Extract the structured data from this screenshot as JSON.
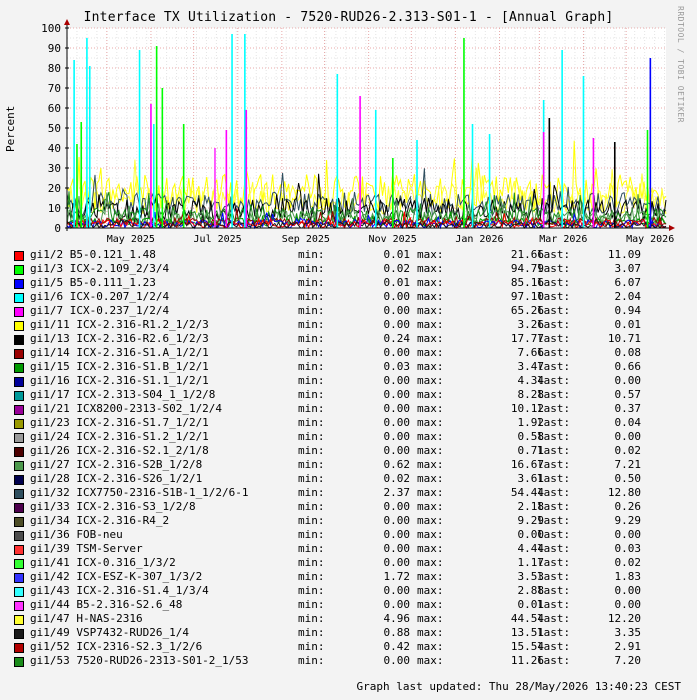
{
  "chart_data": {
    "type": "line",
    "title": "Interface TX Utilization - 7520-RUD26-2.313-S01-1 - [Annual Graph]",
    "ylabel": "Percent",
    "side_label": "RRDTOOL / TOBI OETIKER",
    "ylim": [
      0,
      100
    ],
    "y_ticks": [
      "0",
      "10",
      "20",
      "30",
      "40",
      "50",
      "60",
      "70",
      "80",
      "90",
      "100"
    ],
    "x_ticks": [
      "May 2025",
      "Jul 2025",
      "Sep 2025",
      "Nov 2025",
      "Jan 2026",
      "Mar 2026",
      "May 2026"
    ],
    "grid": true,
    "legend_position": "bottom",
    "footer": "Graph last updated: Thu 28/May/2026 13:40:23 CEST",
    "labels": {
      "min": "min:",
      "max": "max:",
      "last": "last:"
    },
    "series": [
      {
        "name": "gi1/2 B5-0.121_1.48",
        "color": "#ff0000",
        "min": "0.01",
        "max": "21.66",
        "last": "11.09"
      },
      {
        "name": "gi1/3 ICX-2.109_2/3/4",
        "color": "#00ff00",
        "min": "0.02",
        "max": "94.79",
        "last": "3.07"
      },
      {
        "name": "gi1/5 B5-0.111_1.23",
        "color": "#0000ff",
        "min": "0.01",
        "max": "85.16",
        "last": "6.07"
      },
      {
        "name": "gi1/6 ICX-0.207_1/2/4",
        "color": "#00ffff",
        "min": "0.00",
        "max": "97.10",
        "last": "2.04"
      },
      {
        "name": "gi1/7 ICX-0.237_1/2/4",
        "color": "#ff00ff",
        "min": "0.00",
        "max": "65.26",
        "last": "0.94"
      },
      {
        "name": "gi1/11 ICX-2.316-R1.2_1/2/3",
        "color": "#ffff00",
        "min": "0.00",
        "max": "3.26",
        "last": "0.01"
      },
      {
        "name": "gi1/13 ICX-2.316-R2.6_1/2/3",
        "color": "#000000",
        "min": "0.24",
        "max": "17.77",
        "last": "10.71"
      },
      {
        "name": "gi1/14 ICX-2.316-S1.A_1/2/1",
        "color": "#990000",
        "min": "0.00",
        "max": "7.66",
        "last": "0.08"
      },
      {
        "name": "gi1/15 ICX-2.316-S1.B_1/2/1",
        "color": "#009900",
        "min": "0.03",
        "max": "3.47",
        "last": "0.66"
      },
      {
        "name": "gi1/16 ICX-2.316-S1.1_1/2/1",
        "color": "#000099",
        "min": "0.00",
        "max": "4.34",
        "last": "0.00"
      },
      {
        "name": "gi1/17 ICX-2.313-S04_1_1/2/8",
        "color": "#009999",
        "min": "0.00",
        "max": "8.28",
        "last": "0.57"
      },
      {
        "name": "gi1/21 ICX8200-2313-S02_1/2/4",
        "color": "#990099",
        "min": "0.00",
        "max": "10.12",
        "last": "0.37"
      },
      {
        "name": "gi1/23 ICX-2.316-S1.7_1/2/1",
        "color": "#999900",
        "min": "0.00",
        "max": "1.92",
        "last": "0.04"
      },
      {
        "name": "gi1/24 ICX-2.316-S1.2_1/2/1",
        "color": "#999999",
        "min": "0.00",
        "max": "0.58",
        "last": "0.00"
      },
      {
        "name": "gi1/26 ICX-2.316-S2.1_2/1/8",
        "color": "#4d0000",
        "min": "0.00",
        "max": "0.71",
        "last": "0.02"
      },
      {
        "name": "gi1/27 ICX-2.316-S2B_1/2/8",
        "color": "#4d994d",
        "min": "0.62",
        "max": "16.67",
        "last": "7.21"
      },
      {
        "name": "gi1/28 ICX-2.316-S26_1/2/1",
        "color": "#00004d",
        "min": "0.02",
        "max": "3.61",
        "last": "0.50"
      },
      {
        "name": "gi1/32 ICX7750-2316-S1B-1_1/2/6-1",
        "color": "#2f4f5f",
        "min": "2.37",
        "max": "54.44",
        "last": "12.80"
      },
      {
        "name": "gi1/33 ICX-2.316-S3_1/2/8",
        "color": "#4d004d",
        "min": "0.00",
        "max": "2.18",
        "last": "0.26"
      },
      {
        "name": "gi1/34 ICX-2.316-R4_2",
        "color": "#4d4d26",
        "min": "0.00",
        "max": "9.29",
        "last": "9.29"
      },
      {
        "name": "gi1/36 FOB-neu",
        "color": "#4d4d4d",
        "min": "0.00",
        "max": "0.00",
        "last": "0.00"
      },
      {
        "name": "gi1/39 TSM-Server",
        "color": "#ff3333",
        "min": "0.00",
        "max": "4.44",
        "last": "0.03"
      },
      {
        "name": "gi1/41 ICX-0.316_1/3/2",
        "color": "#33ff33",
        "min": "0.00",
        "max": "1.17",
        "last": "0.02"
      },
      {
        "name": "gi1/42 ICX-ESZ-K-307_1/3/2",
        "color": "#3333ff",
        "min": "1.72",
        "max": "3.53",
        "last": "1.83"
      },
      {
        "name": "gi1/43 ICX-2.316-S1.4_1/3/4",
        "color": "#33ffff",
        "min": "0.00",
        "max": "2.88",
        "last": "0.00"
      },
      {
        "name": "gi1/44 B5-2.316-S2.6_48",
        "color": "#ff33ff",
        "min": "0.00",
        "max": "0.01",
        "last": "0.00"
      },
      {
        "name": "gi1/47 H-NAS-2316",
        "color": "#ffff33",
        "min": "4.96",
        "max": "44.54",
        "last": "12.20"
      },
      {
        "name": "gi1/49 VSP7432-RUD26_1/4",
        "color": "#1a1a1a",
        "min": "0.88",
        "max": "13.51",
        "last": "3.35"
      },
      {
        "name": "gi1/52 ICX-2316-S2.3_1/2/6",
        "color": "#b30000",
        "min": "0.42",
        "max": "15.54",
        "last": "2.91"
      },
      {
        "name": "gi1/53 7520-RUD26-2313-S01-2_1/53",
        "color": "#1a8c1a",
        "min": "0.00",
        "max": "11.26",
        "last": "7.20"
      }
    ],
    "spikes": [
      {
        "x": "2025-04-08",
        "y": 84,
        "color": "#00ffff"
      },
      {
        "x": "2025-04-10",
        "y": 42,
        "color": "#00ff00"
      },
      {
        "x": "2025-04-13",
        "y": 53,
        "color": "#00ff00"
      },
      {
        "x": "2025-04-17",
        "y": 95,
        "color": "#00ffff"
      },
      {
        "x": "2025-04-19",
        "y": 81,
        "color": "#00ffff"
      },
      {
        "x": "2025-05-24",
        "y": 89,
        "color": "#00ffff"
      },
      {
        "x": "2025-06-01",
        "y": 62,
        "color": "#ff00ff"
      },
      {
        "x": "2025-06-03",
        "y": 52,
        "color": "#00ffff"
      },
      {
        "x": "2025-06-05",
        "y": 91,
        "color": "#00ff00"
      },
      {
        "x": "2025-06-09",
        "y": 70,
        "color": "#00ff00"
      },
      {
        "x": "2025-06-24",
        "y": 52,
        "color": "#00ff00"
      },
      {
        "x": "2025-07-16",
        "y": 40,
        "color": "#ff33ff"
      },
      {
        "x": "2025-07-24",
        "y": 49,
        "color": "#ff00ff"
      },
      {
        "x": "2025-07-28",
        "y": 97,
        "color": "#00ffff"
      },
      {
        "x": "2025-08-06",
        "y": 97,
        "color": "#00ffff"
      },
      {
        "x": "2025-08-07",
        "y": 59,
        "color": "#ff00ff"
      },
      {
        "x": "2025-10-10",
        "y": 77,
        "color": "#00ffff"
      },
      {
        "x": "2025-10-26",
        "y": 66,
        "color": "#ff00ff"
      },
      {
        "x": "2025-11-06",
        "y": 59,
        "color": "#00ffff"
      },
      {
        "x": "2025-11-18",
        "y": 35,
        "color": "#00ff00"
      },
      {
        "x": "2025-12-05",
        "y": 44,
        "color": "#00ffff"
      },
      {
        "x": "2026-01-07",
        "y": 95,
        "color": "#00ff00"
      },
      {
        "x": "2026-01-13",
        "y": 52,
        "color": "#00ffff"
      },
      {
        "x": "2026-01-25",
        "y": 47,
        "color": "#00ffff"
      },
      {
        "x": "2026-03-04",
        "y": 64,
        "color": "#00ffff"
      },
      {
        "x": "2026-03-04",
        "y": 48,
        "color": "#ff00ff"
      },
      {
        "x": "2026-03-08",
        "y": 55,
        "color": "#000000"
      },
      {
        "x": "2026-03-17",
        "y": 89,
        "color": "#00ffff"
      },
      {
        "x": "2026-04-01",
        "y": 76,
        "color": "#00ffff"
      },
      {
        "x": "2026-04-08",
        "y": 45,
        "color": "#ff00ff"
      },
      {
        "x": "2026-04-23",
        "y": 43,
        "color": "#000000"
      },
      {
        "x": "2026-05-16",
        "y": 49,
        "color": "#00ff00"
      },
      {
        "x": "2026-05-18",
        "y": 85,
        "color": "#0000ff"
      }
    ]
  }
}
